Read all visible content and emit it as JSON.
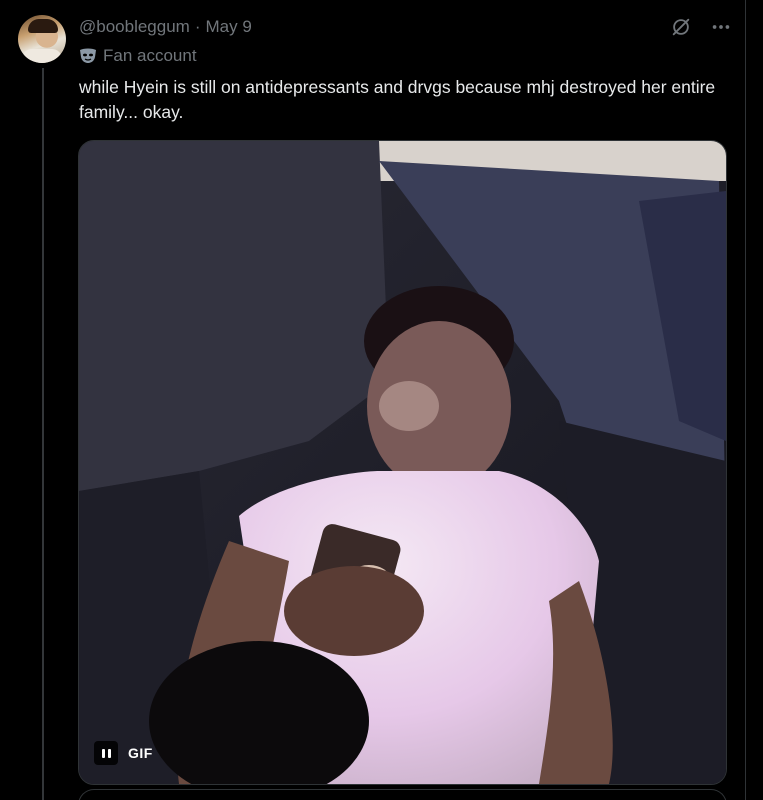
{
  "tweet": {
    "handle": "@boobleggum",
    "separator": "·",
    "date": "May 9",
    "label": "Fan account",
    "label_icon": "mask-icon",
    "text": "while Hyein is still on antidepressants and drvgs because mhj destroyed her entire family... okay.",
    "media": {
      "type": "GIF",
      "badge": "GIF",
      "control_icon": "pause-icon"
    },
    "icons": [
      "grok-icon",
      "more-icon"
    ]
  },
  "colors": {
    "background": "#000000",
    "text": "#e7e9ea",
    "secondary": "#71767b",
    "border": "#2f3336"
  }
}
